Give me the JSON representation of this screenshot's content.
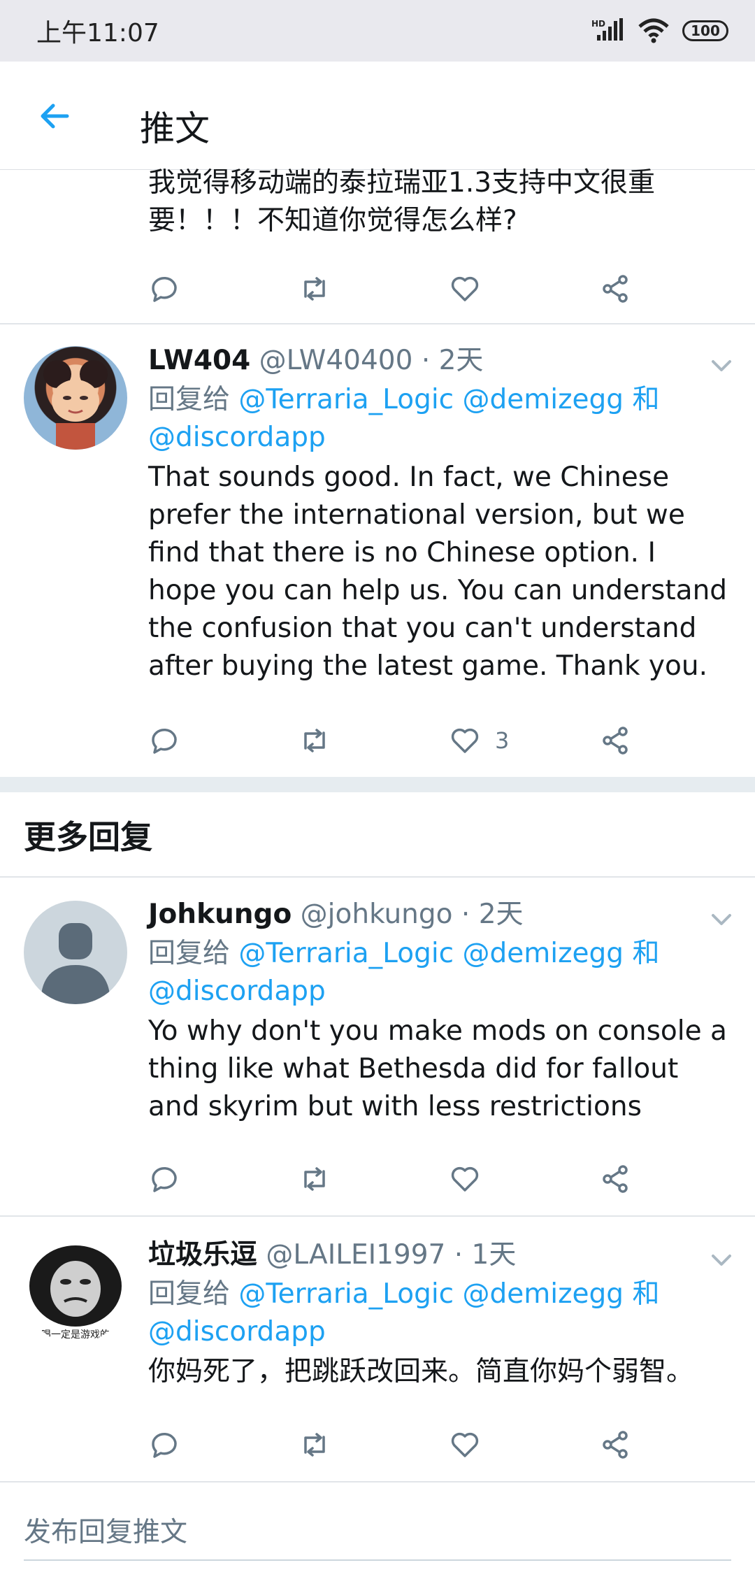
{
  "status": {
    "time": "上午11:07",
    "battery": "100",
    "signal_label": "HD"
  },
  "appbar": {
    "title": "推文"
  },
  "top_tweet": {
    "text": "我觉得移动端的泰拉瑞亚1.3支持中文很重要！！！不知道你觉得怎么样?"
  },
  "tweets": [
    {
      "name": "LW404",
      "handle": "@LW40400 · 2天",
      "reply_prefix": "回复给",
      "mentions": "@Terraria_Logic @demizegg 和",
      "mentions2": "@discordapp",
      "text": "That sounds good. In fact, we Chinese prefer the international version, but we find that there is no Chinese option. I hope you can help us. You can understand the confusion that you can't understand after buying the latest game. Thank you.",
      "like_count": "3"
    }
  ],
  "more_replies": {
    "title": "更多回复",
    "items": [
      {
        "name": "Johkungo",
        "handle": "@johkungo · 2天",
        "reply_prefix": "回复给",
        "mentions": "@Terraria_Logic @demizegg 和",
        "mentions2": "@discordapp",
        "text": "Yo why don't you make mods on console a thing like what Bethesda did for fallout and skyrim but with less restrictions"
      },
      {
        "name": "垃圾乐逗",
        "handle": "@LAILEI1997 · 1天",
        "reply_prefix": "回复给",
        "mentions": "@Terraria_Logic @demizegg 和",
        "mentions2": "@discordapp",
        "text": "你妈死了，把跳跃改回来。简直你妈个弱智。",
        "avatar_caption": "唱一定是游戏的"
      }
    ]
  },
  "compose": {
    "placeholder": "发布回复推文"
  },
  "colors": {
    "accent": "#1da1f2",
    "secondary": "#657786",
    "icon": "#657786"
  }
}
